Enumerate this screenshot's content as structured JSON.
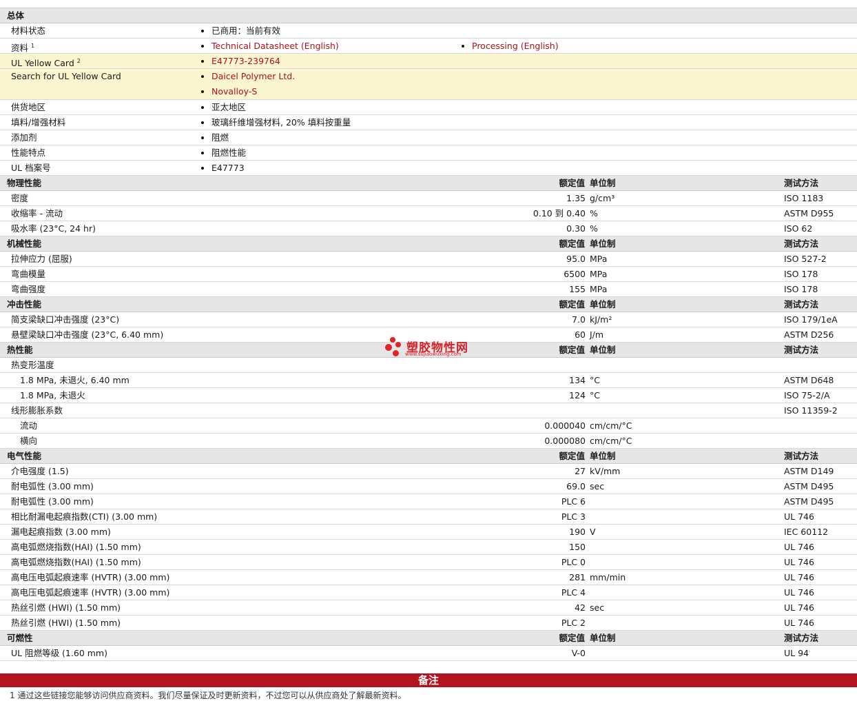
{
  "general": {
    "title": "总体",
    "rows": [
      {
        "label": "材料状态",
        "items": [
          "已商用：当前有效"
        ]
      },
      {
        "label": "资料",
        "sup": "1",
        "items": [
          "Technical Datasheet (English)"
        ],
        "items2": [
          "Processing (English)"
        ]
      },
      {
        "label": "UL Yellow Card",
        "sup": "2",
        "items": [
          "E47773-239764"
        ]
      },
      {
        "label": "Search for UL Yellow Card",
        "items": [
          "Daicel Polymer Ltd.",
          "Novalloy-S"
        ]
      },
      {
        "label": "供货地区",
        "items": [
          "亚太地区"
        ]
      },
      {
        "label": "填料/增强材料",
        "items": [
          "玻璃纤维增强材料, 20% 填料按重量"
        ]
      },
      {
        "label": "添加剂",
        "items": [
          "阻燃"
        ]
      },
      {
        "label": "性能特点",
        "items": [
          "阻燃性能"
        ]
      },
      {
        "label": "UL 档案号",
        "items": [
          "E47773"
        ]
      }
    ]
  },
  "headers": {
    "value": "额定值",
    "unit": "单位制",
    "method": "测试方法"
  },
  "physical": {
    "title": "物理性能",
    "rows": [
      {
        "label": "密度",
        "value": "1.35",
        "unit": "g/cm³",
        "method": "ISO 1183"
      },
      {
        "label": "收缩率  - 流动",
        "value": "0.10 到  0.40",
        "unit": "%",
        "method": "ASTM D955"
      },
      {
        "label": "吸水率  (23°C, 24 hr)",
        "value": "0.30",
        "unit": "%",
        "method": "ISO 62"
      }
    ]
  },
  "mechanical": {
    "title": "机械性能",
    "rows": [
      {
        "label": "拉伸应力  (屈服)",
        "value": "95.0",
        "unit": "MPa",
        "method": "ISO 527-2"
      },
      {
        "label": "弯曲模量",
        "value": "6500",
        "unit": "MPa",
        "method": "ISO 178"
      },
      {
        "label": "弯曲强度",
        "value": "155",
        "unit": "MPa",
        "method": "ISO 178"
      }
    ]
  },
  "impact": {
    "title": "冲击性能",
    "rows": [
      {
        "label": "简支梁缺口冲击强度  (23°C)",
        "value": "7.0",
        "unit": "kJ/m²",
        "method": "ISO 179/1eA"
      },
      {
        "label": "悬壁梁缺口冲击强度  (23°C, 6.40 mm)",
        "value": "60",
        "unit": "J/m",
        "method": "ASTM D256"
      }
    ]
  },
  "thermal": {
    "title": "热性能",
    "rows": [
      {
        "label": "热变形温度",
        "value": "",
        "unit": "",
        "method": ""
      },
      {
        "label": "1.8 MPa, 未退火, 6.40 mm",
        "indent": true,
        "value": "134",
        "unit": "°C",
        "method": "ASTM D648"
      },
      {
        "label": "1.8 MPa, 未退火",
        "indent": true,
        "value": "124",
        "unit": "°C",
        "method": "ISO 75-2/A"
      },
      {
        "label": "线形膨胀系数",
        "value": "",
        "unit": "",
        "method": "ISO 11359-2"
      },
      {
        "label": "流动",
        "indent": true,
        "value": "0.000040",
        "unit": "cm/cm/°C",
        "method": ""
      },
      {
        "label": "横向",
        "indent": true,
        "value": "0.000080",
        "unit": "cm/cm/°C",
        "method": ""
      }
    ]
  },
  "electrical": {
    "title": "电气性能",
    "rows": [
      {
        "label": "介电强度  (1.5)",
        "value": "27",
        "unit": "kV/mm",
        "method": "ASTM D149"
      },
      {
        "label": "耐电弧性  (3.00 mm)",
        "value": "69.0",
        "unit": "sec",
        "method": "ASTM D495"
      },
      {
        "label": "耐电弧性  (3.00 mm)",
        "value": "PLC 6",
        "unit": "",
        "method": "ASTM D495"
      },
      {
        "label": "相比耐漏电起痕指数(CTI) (3.00 mm)",
        "value": "PLC 3",
        "unit": "",
        "method": "UL 746"
      },
      {
        "label": "漏电起痕指数  (3.00 mm)",
        "value": "190",
        "unit": "V",
        "method": "IEC 60112"
      },
      {
        "label": "高电弧燃烧指数(HAI) (1.50 mm)",
        "value": "150",
        "unit": "",
        "method": "UL 746"
      },
      {
        "label": "高电弧燃烧指数(HAI) (1.50 mm)",
        "value": "PLC 0",
        "unit": "",
        "method": "UL 746"
      },
      {
        "label": "高电压电弧起痕速率  (HVTR) (3.00 mm)",
        "value": "281",
        "unit": "mm/min",
        "method": "UL 746"
      },
      {
        "label": "高电压电弧起痕速率  (HVTR) (3.00 mm)",
        "value": "PLC 4",
        "unit": "",
        "method": "UL 746"
      },
      {
        "label": "热丝引燃  (HWI) (1.50 mm)",
        "value": "42",
        "unit": "sec",
        "method": "UL 746"
      },
      {
        "label": "热丝引燃  (HWI) (1.50 mm)",
        "value": "PLC 2",
        "unit": "",
        "method": "UL 746"
      }
    ]
  },
  "flammability": {
    "title": "可燃性",
    "rows": [
      {
        "label": "UL 阻燃等级  (1.60 mm)",
        "value": "V-0",
        "unit": "",
        "method": "UL 94"
      }
    ]
  },
  "notes": {
    "title": "备注",
    "footnote": "1 通过这些链接您能够访问供应商资料。我们尽量保证及时更新资料，不过您可以从供应商处了解最新资料。"
  },
  "watermark": {
    "name": "塑胶物性网",
    "url": "www.sujiaowuxing.com"
  },
  "colors": {
    "section_bg": "#e6e6e6",
    "yellow_bg": "#fbf6d0",
    "link": "#b10f1f",
    "notes_bar": "#b3141f"
  }
}
